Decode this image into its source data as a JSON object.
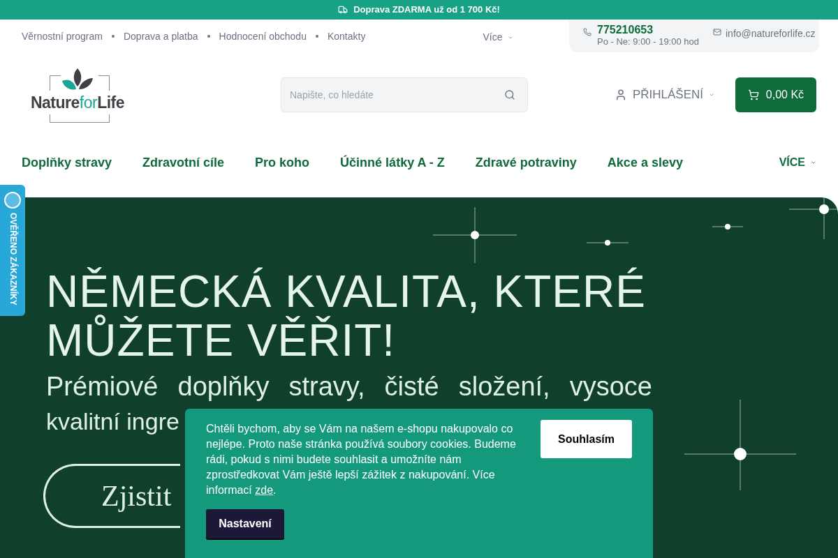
{
  "promo_bar": {
    "text": "Doprava ZDARMA už od 1 700 Kč!"
  },
  "top_links": [
    "Věrnostní program",
    "Doprava a platba",
    "Hodnocení obchodu",
    "Kontakty"
  ],
  "top_more": "Více",
  "contact": {
    "phone": "775210653",
    "hours": "Po - Ne: 9:00 - 19:00 hod",
    "email": "info@natureforlife.cz"
  },
  "logo": {
    "part_1": "Nature",
    "part_2": "for",
    "part_3": "Life"
  },
  "search": {
    "placeholder": "Napište, co hledáte"
  },
  "login": "PŘIHLÁŠENÍ",
  "cart": {
    "total": "0,00 Kč"
  },
  "nav": [
    "Doplňky stravy",
    "Zdravotní cíle",
    "Pro koho",
    "Účinné látky A - Z",
    "Zdravé potraviny",
    "Akce a slevy"
  ],
  "nav_more": "VÍCE",
  "badge": {
    "text": "OVĚŘENO ZÁKAZNÍKY"
  },
  "hero": {
    "heading_line_1": "NĚMECKÁ KVALITA, KTERÉ",
    "heading_line_2": "MŮŽETE VĚŘIT!",
    "subtitle_line_1": "Prémiové doplňky stravy, čisté složení, vysoce",
    "subtitle_line_2": "kvalitní ingre",
    "button": "Zjistit"
  },
  "cookie": {
    "text": "Chtěli bychom, aby se Vám na našem e-shopu nakupovalo co nejlépe. Proto naše stránka používá soubory cookies. Budeme rádi, pokud s nimi budete souhlasit a umožníte nám zprostředkovat Vám ještě lepší zážitek z nakupování. Více informací",
    "link": "zde",
    "after": ".",
    "accept": "Souhlasím",
    "settings": "Nastavení"
  }
}
